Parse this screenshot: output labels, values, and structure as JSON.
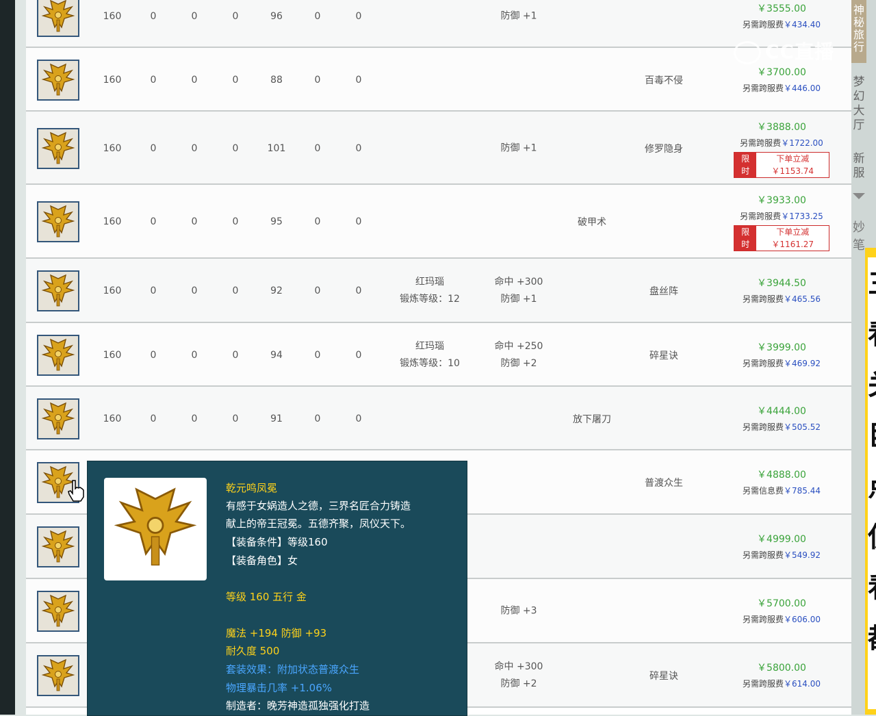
{
  "rows": [
    {
      "level": "160",
      "c1": "0",
      "c2": "0",
      "c3": "0",
      "c4": "96",
      "c5": "0",
      "c6": "0",
      "gem": [],
      "attr": [
        "防御 +1"
      ],
      "special": "",
      "skill": "",
      "price": "￥3555.00",
      "fee_label": "另需跨服费",
      "fee": "￥434.40",
      "promo": null
    },
    {
      "level": "160",
      "c1": "0",
      "c2": "0",
      "c3": "0",
      "c4": "88",
      "c5": "0",
      "c6": "0",
      "gem": [],
      "attr": [],
      "special": "",
      "skill": "百毒不侵",
      "price": "￥3700.00",
      "fee_label": "另需跨服费",
      "fee": "￥446.00",
      "promo": null
    },
    {
      "level": "160",
      "c1": "0",
      "c2": "0",
      "c3": "0",
      "c4": "101",
      "c5": "0",
      "c6": "0",
      "gem": [],
      "attr": [
        "防御 +1"
      ],
      "special": "",
      "skill": "修罗隐身",
      "price": "￥3888.00",
      "fee_label": "另需跨服费",
      "fee": "￥1722.00",
      "promo": {
        "tag": "限时",
        "text": "下单立减￥1153.74"
      }
    },
    {
      "level": "160",
      "c1": "0",
      "c2": "0",
      "c3": "0",
      "c4": "95",
      "c5": "0",
      "c6": "0",
      "gem": [],
      "attr": [],
      "special": "破甲术",
      "skill": "",
      "price": "￥3933.00",
      "fee_label": "另需跨服费",
      "fee": "￥1733.25",
      "promo": {
        "tag": "限时",
        "text": "下单立减￥1161.27"
      }
    },
    {
      "level": "160",
      "c1": "0",
      "c2": "0",
      "c3": "0",
      "c4": "92",
      "c5": "0",
      "c6": "0",
      "gem": [
        "红玛瑙",
        "锻炼等级：12"
      ],
      "attr": [
        "命中 +300",
        "防御 +1"
      ],
      "special": "",
      "skill": "盘丝阵",
      "price": "￥3944.50",
      "fee_label": "另需跨服费",
      "fee": "￥465.56",
      "promo": null
    },
    {
      "level": "160",
      "c1": "0",
      "c2": "0",
      "c3": "0",
      "c4": "94",
      "c5": "0",
      "c6": "0",
      "gem": [
        "红玛瑙",
        "锻炼等级：10"
      ],
      "attr": [
        "命中 +250",
        "防御 +2"
      ],
      "special": "",
      "skill": "碎星诀",
      "price": "￥3999.00",
      "fee_label": "另需跨服费",
      "fee": "￥469.92",
      "promo": null
    },
    {
      "level": "160",
      "c1": "0",
      "c2": "0",
      "c3": "0",
      "c4": "91",
      "c5": "0",
      "c6": "0",
      "gem": [],
      "attr": [],
      "special": "放下屠刀",
      "skill": "",
      "price": "￥4444.00",
      "fee_label": "另需跨服费",
      "fee": "￥505.52",
      "promo": null
    },
    {
      "level": "",
      "c1": "",
      "c2": "",
      "c3": "",
      "c4": "",
      "c5": "",
      "c6": "",
      "gem": [],
      "attr": [],
      "special": "",
      "skill": "普渡众生",
      "price": "￥4888.00",
      "fee_label": "另需信息费",
      "fee": "￥785.44",
      "promo": null
    },
    {
      "level": "",
      "c1": "",
      "c2": "",
      "c3": "",
      "c4": "",
      "c5": "",
      "c6": "",
      "gem": [],
      "attr": [],
      "special": "",
      "skill": "",
      "price": "￥4999.00",
      "fee_label": "另需跨服费",
      "fee": "￥549.92",
      "promo": null
    },
    {
      "level": "",
      "c1": "",
      "c2": "",
      "c3": "",
      "c4": "",
      "c5": "",
      "c6": "",
      "gem": [],
      "attr": [
        "防御 +3"
      ],
      "special": "",
      "skill": "",
      "price": "￥5700.00",
      "fee_label": "另需跨服费",
      "fee": "￥606.00",
      "promo": null
    },
    {
      "level": "",
      "c1": "",
      "c2": "",
      "c3": "",
      "c4": "",
      "c5": "",
      "c6": "",
      "gem": [],
      "attr": [
        "命中 +300",
        "防御 +2"
      ],
      "special": "",
      "skill": "碎星诀",
      "price": "￥5800.00",
      "fee_label": "另需跨服费",
      "fee": "￥614.00",
      "promo": null
    }
  ],
  "tooltip": {
    "name": "乾元鸣凤冕",
    "desc1": "有感于女娲造人之德，三界名匠合力铸造",
    "desc2": "献上的帝王冠冕。五德齐聚，凤仪天下。",
    "req_level": "【装备条件】等级160",
    "req_role": "【装备角色】女",
    "level_line": "等级 160 五行 金",
    "stats": "魔法 +194 防御 +93",
    "durability": "耐久度 500",
    "set_effect": "套装效果：附加状态普渡众生",
    "crit": "物理暴击几率 +1.06%",
    "maker": "制造者：晚芳神造孤独强化打造"
  },
  "side": {
    "tab_a": "神秘旅行",
    "tab_b": "梦幻大厅",
    "tab_c": "新服",
    "tab_d": "妙笔",
    "promo_chars": [
      "三",
      "看",
      "关",
      "巨",
      "点",
      "使",
      "看",
      "都"
    ]
  },
  "watermark": "CC直播",
  "colors": {
    "price_green": "#3aa33a",
    "fee_blue": "#2a4fc0",
    "promo_red": "#d43030",
    "tooltip_bg": "#1a4a5a",
    "tooltip_yellow": "#ffd21a"
  }
}
